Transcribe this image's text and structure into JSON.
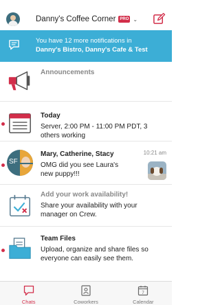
{
  "header": {
    "workspace_title": "Danny's Coffee Corner",
    "badge": "PRO",
    "accent_color": "#d22e4a"
  },
  "notification_banner": {
    "line1": "You have 12 more notifications in",
    "line2": "Danny's Bistro, Danny's Cafe & Test",
    "background": "#3caed6"
  },
  "feed": {
    "announcements": {
      "heading": "Announcements",
      "icon": "megaphone-icon"
    },
    "today": {
      "heading": "Today",
      "body": "Server, 2:00 PM - 11:00 PM PDT, 3 others working",
      "icon": "calendar-icon",
      "unread": true
    },
    "chat": {
      "heading": "Mary, Catherine, Stacy",
      "time": "10:21 am",
      "body": "OMG did you see Laura's new puppy!!!",
      "avatar_initials": "SF",
      "unread": true
    },
    "availability": {
      "heading": "Add your work availability!",
      "body": "Share your availability with your manager on Crew.",
      "icon": "calendar-check-icon"
    },
    "team_files": {
      "heading": "Team Files",
      "body": "Upload, organize and share files so everyone can easily see them.",
      "icon": "folder-icon",
      "unread": true
    }
  },
  "tabs": [
    {
      "label": "Chats",
      "icon": "chat-icon",
      "active": true
    },
    {
      "label": "Coworkers",
      "icon": "contact-card-icon",
      "active": false
    },
    {
      "label": "Calendar",
      "icon": "calendar-icon",
      "day": "7",
      "active": false
    }
  ]
}
